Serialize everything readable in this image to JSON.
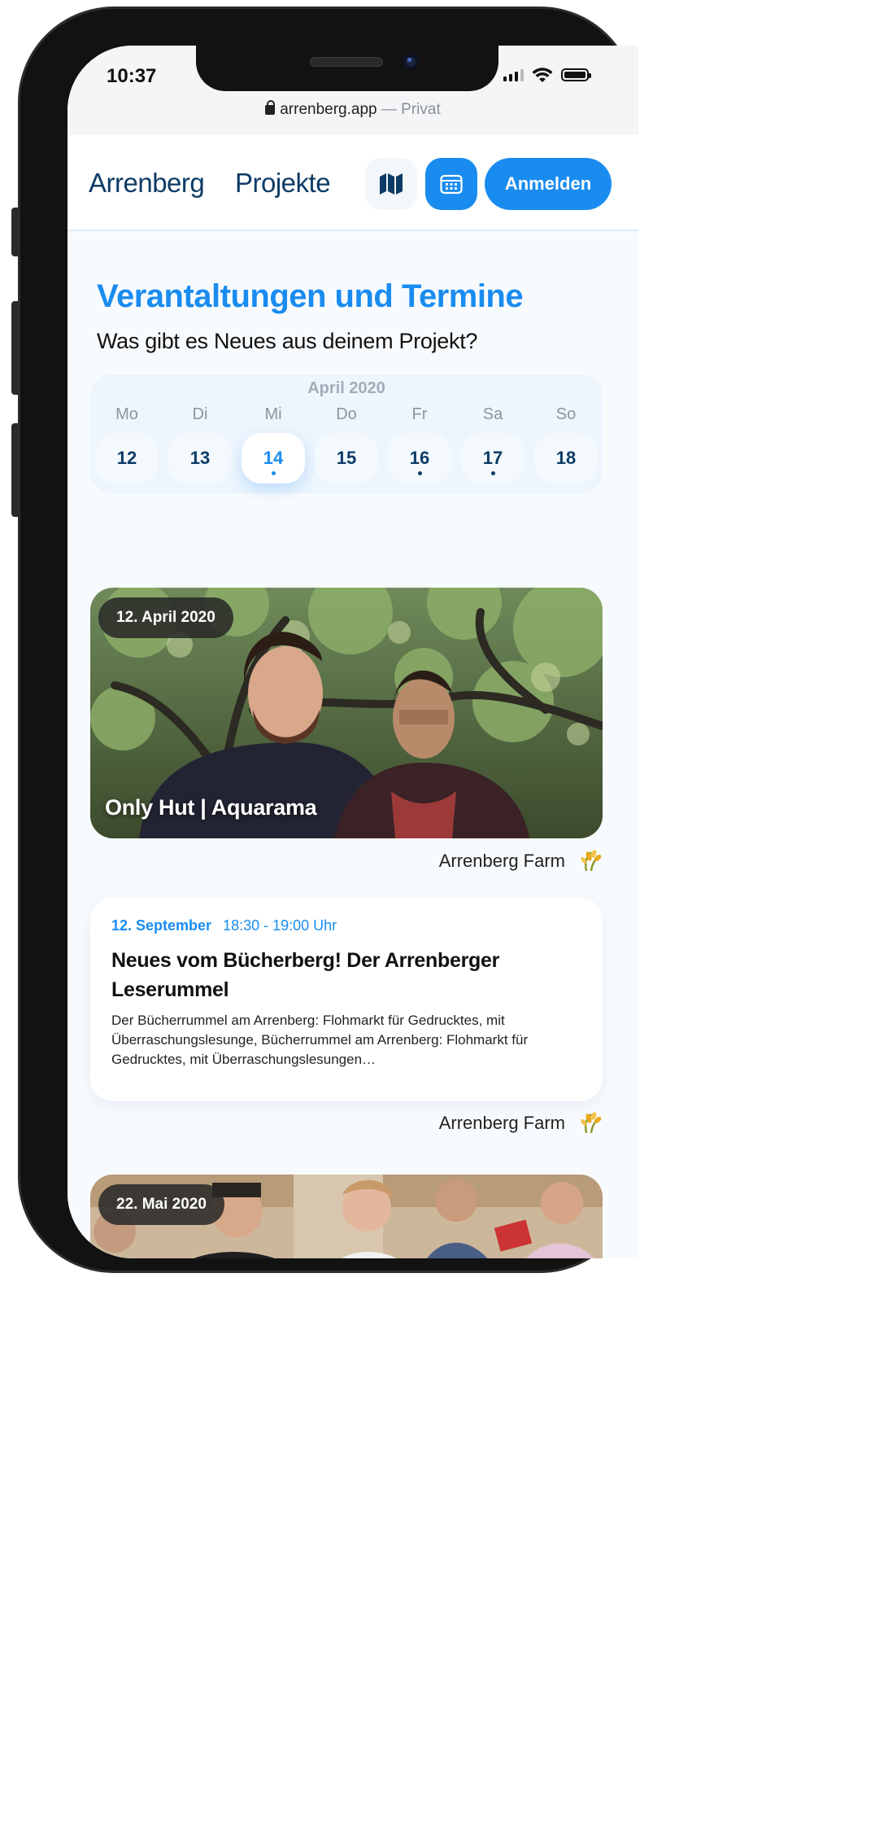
{
  "status_bar": {
    "time": "10:37"
  },
  "browser": {
    "domain": "arrenberg.app",
    "separator": " — ",
    "mode": "Privat"
  },
  "nav": {
    "brand": "Arrenberg",
    "projects": "Projekte",
    "map_icon": "map-icon",
    "calendar_icon": "calendar-icon",
    "login": "Anmelden"
  },
  "page": {
    "title": "Verantaltungen und Termine",
    "subtitle": "Was gibt es Neues aus deinem Projekt?"
  },
  "calendar": {
    "month": "April 2020",
    "days": [
      {
        "name": "Mo",
        "num": "12",
        "active": false,
        "dot": false
      },
      {
        "name": "Di",
        "num": "13",
        "active": false,
        "dot": false
      },
      {
        "name": "Mi",
        "num": "14",
        "active": true,
        "dot": true
      },
      {
        "name": "Do",
        "num": "15",
        "active": false,
        "dot": false
      },
      {
        "name": "Fr",
        "num": "16",
        "active": false,
        "dot": true
      },
      {
        "name": "Sa",
        "num": "17",
        "active": false,
        "dot": true
      },
      {
        "name": "So",
        "num": "18",
        "active": false,
        "dot": false
      }
    ]
  },
  "events": [
    {
      "date": "12. April 2020",
      "title": "Only Hut | Aquarama",
      "organizer": "Arrenberg Farm",
      "organizer_icon": "wheat-icon"
    },
    {
      "date": "12. September",
      "time": "18:30 - 19:00 Uhr",
      "title": "Neues vom Bücherberg! Der Arrenberger Leserummel",
      "description": "Der Bücherrummel am Arrenberg: Flohmarkt für Gedrucktes, mit Überraschungslesunge, Bücherrummel am Arrenberg: Flohmarkt für Gedrucktes, mit Überraschungslesungen…",
      "organizer": "Arrenberg Farm",
      "organizer_icon": "wheat-icon"
    },
    {
      "date": "22. Mai 2020"
    }
  ],
  "colors": {
    "accent": "#1a8cf0",
    "navy": "#0d3b66",
    "calendar_bg": "#edf5fd"
  }
}
